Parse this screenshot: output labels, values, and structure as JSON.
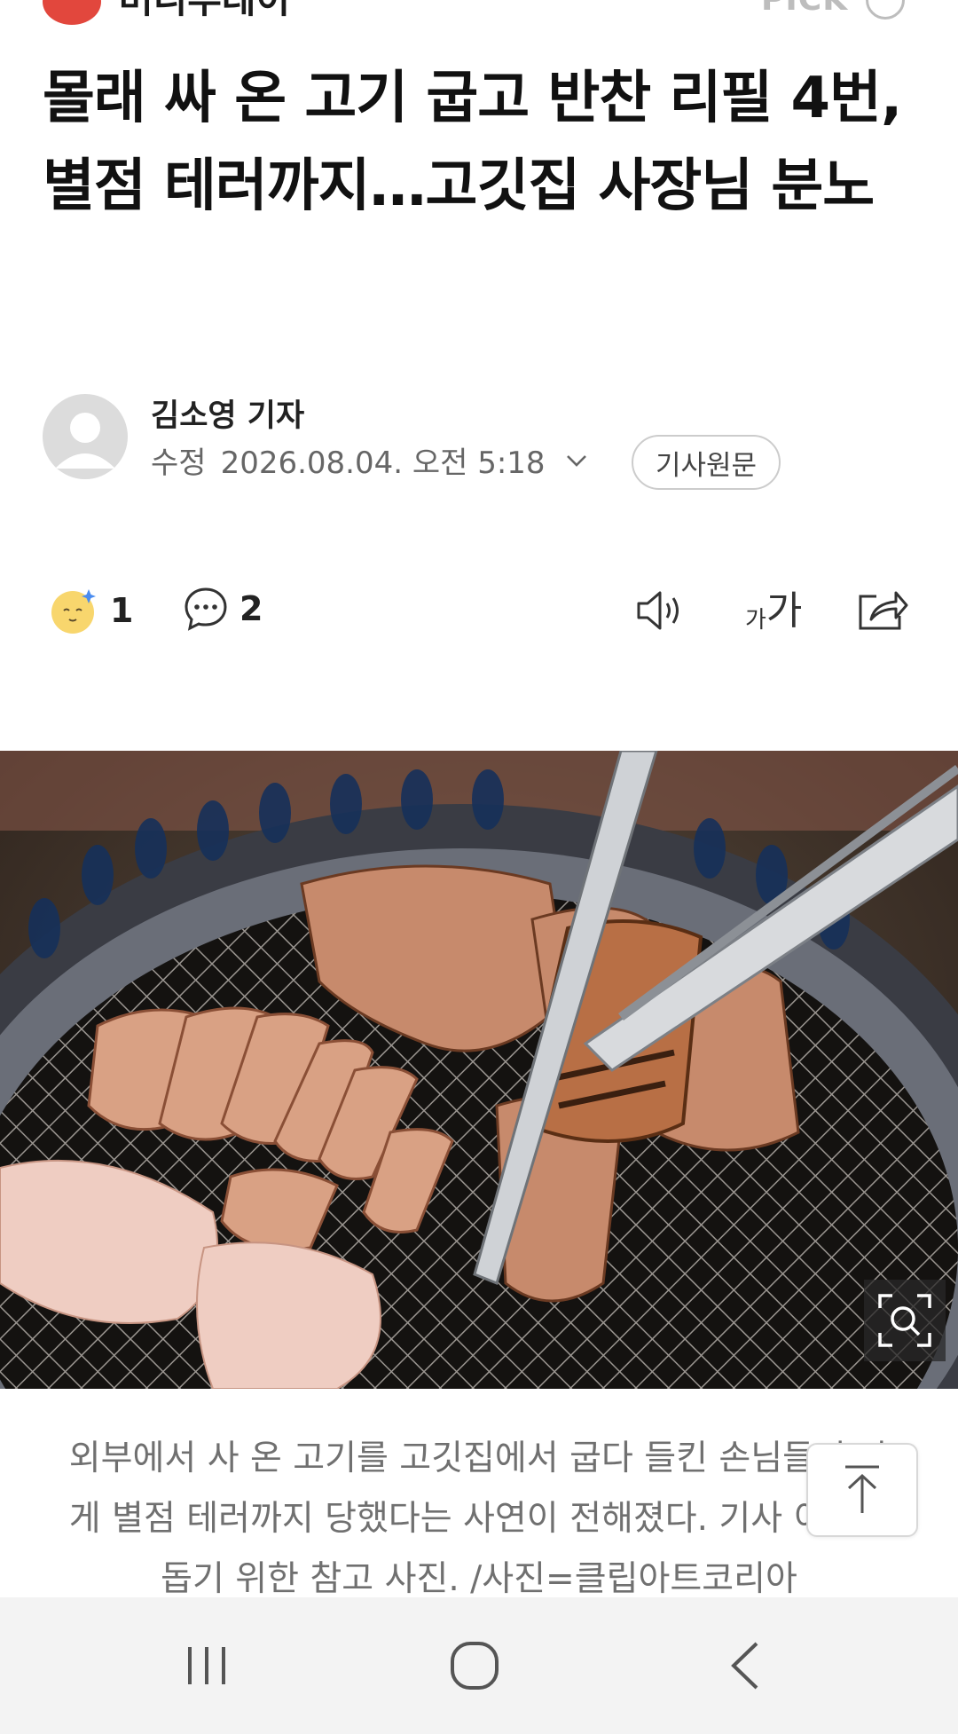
{
  "header": {
    "press_name": "머니투데이",
    "pick_label": "PICK"
  },
  "article": {
    "headline": "몰래 싸 온 고기 굽고 반찬 리필 4번, 별점 테러까지…고깃집 사장님 분노",
    "author": "김소영 기자",
    "date_label": "수정",
    "date": "2026.08.04. 오전 5:18",
    "original_button": "기사원문"
  },
  "actions": {
    "reaction_count": "1",
    "comment_count": "2",
    "font_small": "가",
    "font_big": "가"
  },
  "icons": {
    "press_logo": "press-logo-icon",
    "pick": "pick-info-icon",
    "reaction": "reaction-emoji-icon",
    "comment": "comment-icon",
    "speaker": "speaker-icon",
    "share": "share-icon",
    "zoom": "zoom-icon",
    "scroll_top": "arrow-up-icon"
  },
  "caption": "외부에서 사 온 고기를 고깃집에서 굽다 들킨 손님들이 가게 별점 테러까지 당했다는 사연이 전해졌다. 기사 이해를 돕기 위한 참고 사진. /사진=클립아트코리아",
  "colors": {
    "brand": "#e2473d",
    "text": "#111111",
    "muted": "#707070"
  }
}
